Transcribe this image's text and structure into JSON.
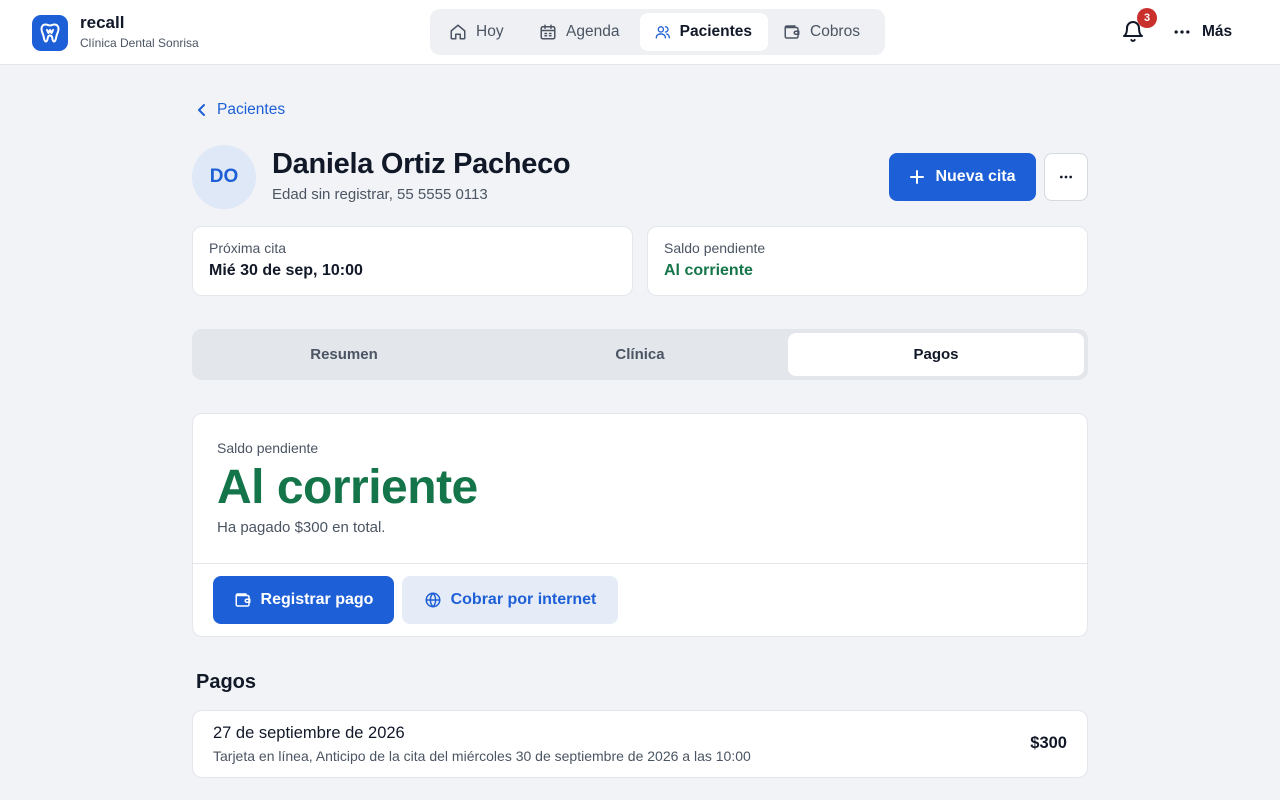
{
  "brand": {
    "name": "recall",
    "subtitle": "Clínica Dental Sonrisa",
    "color": "#1d5fd6"
  },
  "nav": {
    "items": [
      {
        "label": "Hoy",
        "icon": "home-icon",
        "active": false
      },
      {
        "label": "Agenda",
        "icon": "calendar-icon",
        "active": false
      },
      {
        "label": "Pacientes",
        "icon": "users-icon",
        "active": true
      },
      {
        "label": "Cobros",
        "icon": "wallet-icon",
        "active": false
      }
    ]
  },
  "header": {
    "notifications_count": "3",
    "more_label": "Más"
  },
  "breadcrumb": {
    "label": "Pacientes"
  },
  "patient": {
    "initials": "DO",
    "name": "Daniela Ortiz Pacheco",
    "meta": "Edad sin registrar, 55 5555 0113",
    "new_appointment_label": "Nueva cita"
  },
  "summary": {
    "next_label": "Próxima cita",
    "next_value": "Mié 30 de sep, 10:00",
    "balance_label": "Saldo pendiente",
    "balance_value": "Al corriente"
  },
  "tabs": [
    {
      "label": "Resumen",
      "active": false
    },
    {
      "label": "Clínica",
      "active": false
    },
    {
      "label": "Pagos",
      "active": true
    }
  ],
  "balance": {
    "label": "Saldo pendiente",
    "value": "Al corriente",
    "note": "Ha pagado $300 en total.",
    "register_label": "Registrar pago",
    "online_label": "Cobrar por internet",
    "status_color": "#15754a"
  },
  "payments": {
    "title": "Pagos",
    "items": [
      {
        "date": "27 de septiembre de 2026",
        "description": "Tarjeta en línea, Anticipo de la cita del miércoles 30 de septiembre de 2026 a las 10:00",
        "amount": "$300"
      }
    ]
  }
}
